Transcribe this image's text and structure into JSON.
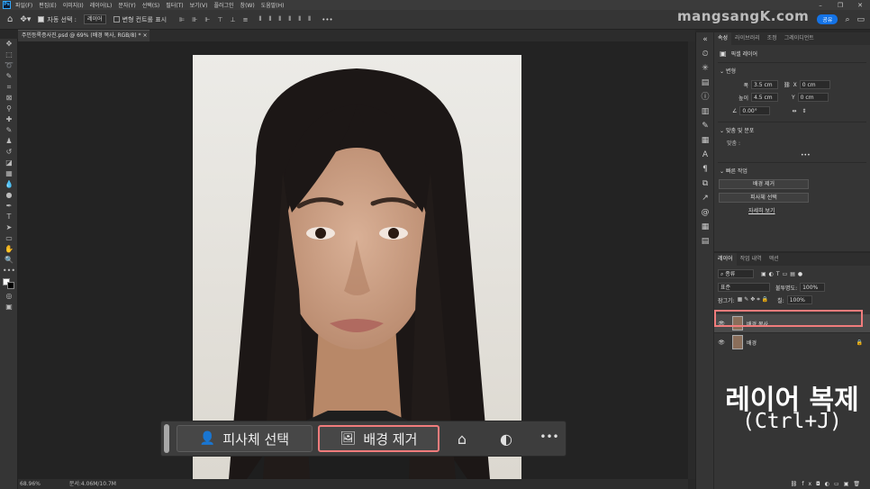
{
  "menubar": {
    "items": [
      "파일(F)",
      "편집(E)",
      "이미지(I)",
      "레이어(L)",
      "문자(Y)",
      "선택(S)",
      "필터(T)",
      "보기(V)",
      "플러그인",
      "창(W)",
      "도움말(H)"
    ]
  },
  "options": {
    "auto_select_label": "자동 선택 :",
    "auto_select_value": "레이어",
    "transform_label": "변형 컨트롤 표시",
    "share_label": "공유"
  },
  "watermark": "mangsangK.com",
  "document": {
    "tab_title": "주민등록증사진.psd @ 69% (배경 복사, RGB/8) *"
  },
  "status": {
    "zoom": "68.96%",
    "doc_info": "문서:4.06M/10.7M"
  },
  "taskbar": {
    "select_subject": "피사체 선택",
    "remove_background": "배경 제거",
    "more": "•••"
  },
  "properties": {
    "tabs": [
      "속성",
      "라이브러리",
      "조정",
      "그레이디언트"
    ],
    "layer_type": "픽셀 레이어",
    "transform_heading": "변형",
    "width_label": "폭",
    "width_value": "3.5 cm",
    "x_label": "X",
    "x_value": "0 cm",
    "height_label": "높이",
    "height_value": "4.5 cm",
    "y_label": "Y",
    "y_value": "0 cm",
    "angle_value": "0.00°",
    "align_heading": "맞춤 및 분포",
    "align_label": "맞춤 :",
    "quick_heading": "빠른 작업",
    "quick_btn1": "배경 제거",
    "quick_btn2": "피사체 선택",
    "quick_link": "자세히 보기"
  },
  "layers": {
    "tabs": [
      "레이어",
      "작업 내역",
      "액션"
    ],
    "kind_label": "종류",
    "blend_mode": "표준",
    "opacity_label": "불투명도:",
    "opacity_value": "100%",
    "lock_label": "잠그기:",
    "fill_label": "칠:",
    "fill_value": "100%",
    "rows": [
      {
        "name": "배경 복사"
      },
      {
        "name": "배경"
      }
    ]
  },
  "overlay": {
    "title": "레이어 복제",
    "subtitle": "(Ctrl+J)"
  }
}
